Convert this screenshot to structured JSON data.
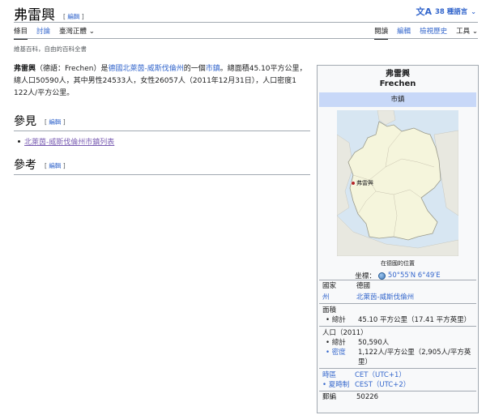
{
  "page": {
    "title": "弗雷興",
    "edit_label": "編輯",
    "languages": "38 種語言",
    "tabs_left": [
      "條目",
      "討論",
      "臺灣正體"
    ],
    "tabs_right": [
      "閱讀",
      "編輯",
      "檢視歷史",
      "工具"
    ],
    "tagline": "維基百科，自由的百科全書"
  },
  "intro": {
    "name": "弗雷興",
    "p1": "（德語：Frechen）是",
    "link1": "德國北萊茵-威斯伐倫州",
    "p2": "的一個",
    "link2": "市鎮",
    "p3": "。總面積45.10平方公里，總人口50590人，其中男性24533人，女性26057人（2011年12月31日），人口密度1 122人/平方公里。"
  },
  "sections": {
    "see_also": "參見",
    "see_also_link": "北萊茵-威斯伐倫州市鎮列表",
    "references": "參考"
  },
  "infobox": {
    "name_zh": "弗雷興",
    "name_de": "Frechen",
    "type": "市鎮",
    "map_label": "弗雷興",
    "map_caption": "在德國的位置",
    "coords_label": "坐標：",
    "coords": "50°55′N 6°49′E",
    "country_label": "國家",
    "country": "德國",
    "state_label": "州",
    "state": "北萊茵-威斯伐倫州",
    "area_label": "面積",
    "area_total_label": "• 總計",
    "area_total": "45.10 平方公里（17.41 平方英里）",
    "pop_label": "人口（2011）",
    "pop_total_label": "• 總計",
    "pop_total": "50,590人",
    "density_label": "• 密度",
    "density": "1,122人/平方公里（2,905人/平方英里）",
    "tz_label": "時區",
    "tz": "CET（UTC+1）",
    "dst_label": "• 夏時制",
    "dst": "CEST（UTC+2）",
    "postal_label": "郵編",
    "postal": "50226"
  },
  "colors": {
    "link": "#3366cc",
    "visited": "#795cb2",
    "infobox_header": "#c8d8f8"
  }
}
